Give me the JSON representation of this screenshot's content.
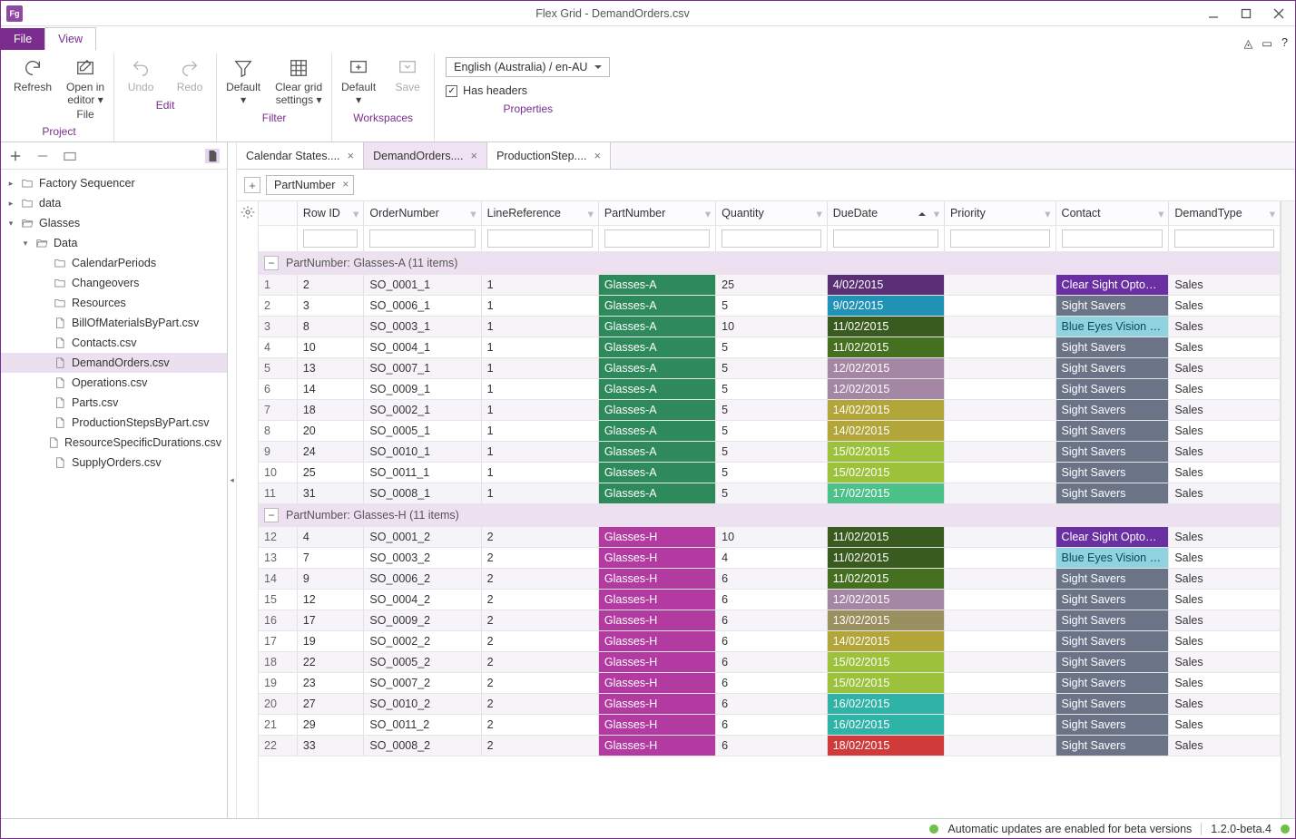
{
  "window_title": "Flex Grid - DemandOrders.csv",
  "menu_tabs": {
    "file": "File",
    "view": "View"
  },
  "ribbon": {
    "project": {
      "refresh": "Refresh",
      "open_in_editor": "Open in\neditor ▾",
      "open_file": "File",
      "group": "Project"
    },
    "edit": {
      "undo": "Undo",
      "redo": "Redo",
      "group": "Edit"
    },
    "filter": {
      "default": "Default\n▾",
      "clear": "Clear grid\nsettings ▾",
      "group": "Filter"
    },
    "workspaces": {
      "default": "Default\n▾",
      "save": "Save",
      "group": "Workspaces"
    },
    "properties": {
      "locale": "English (Australia) / en-AU",
      "has_headers": "Has headers",
      "group": "Properties"
    }
  },
  "sidebar": {
    "nodes": [
      {
        "lvl": 0,
        "twist": "▸",
        "icon": "folder",
        "label": "Factory Sequencer"
      },
      {
        "lvl": 0,
        "twist": "▸",
        "icon": "folder",
        "label": "data"
      },
      {
        "lvl": 0,
        "twist": "▾",
        "icon": "folder-open",
        "label": "Glasses"
      },
      {
        "lvl": 1,
        "twist": "▾",
        "icon": "folder-open",
        "label": "Data"
      },
      {
        "lvl": 2,
        "twist": "",
        "icon": "folder",
        "label": "CalendarPeriods"
      },
      {
        "lvl": 2,
        "twist": "",
        "icon": "folder",
        "label": "Changeovers"
      },
      {
        "lvl": 2,
        "twist": "",
        "icon": "folder",
        "label": "Resources"
      },
      {
        "lvl": 2,
        "twist": "",
        "icon": "file",
        "label": "BillOfMaterialsByPart.csv"
      },
      {
        "lvl": 2,
        "twist": "",
        "icon": "file",
        "label": "Contacts.csv"
      },
      {
        "lvl": 2,
        "twist": "",
        "icon": "file",
        "label": "DemandOrders.csv",
        "sel": true
      },
      {
        "lvl": 2,
        "twist": "",
        "icon": "file",
        "label": "Operations.csv"
      },
      {
        "lvl": 2,
        "twist": "",
        "icon": "file",
        "label": "Parts.csv"
      },
      {
        "lvl": 2,
        "twist": "",
        "icon": "file",
        "label": "ProductionStepsByPart.csv"
      },
      {
        "lvl": 2,
        "twist": "",
        "icon": "file",
        "label": "ResourceSpecificDurations.csv"
      },
      {
        "lvl": 2,
        "twist": "",
        "icon": "file",
        "label": "SupplyOrders.csv"
      }
    ]
  },
  "doc_tabs": [
    {
      "label": "Calendar States....",
      "active": false
    },
    {
      "label": "DemandOrders....",
      "active": true
    },
    {
      "label": "ProductionStep....",
      "active": false
    }
  ],
  "group_chip": "PartNumber",
  "columns": [
    "",
    "Row ID",
    "OrderNumber",
    "LineReference",
    "PartNumber",
    "Quantity",
    "DueDate",
    "Priority",
    "Contact",
    "DemandType"
  ],
  "sorted_col": "DueDate",
  "groups": [
    {
      "title": "PartNumber:  Glasses-A (11 items)",
      "part_color": "#2f8a5b",
      "rows": [
        {
          "n": 1,
          "rowid": "2",
          "order": "SO_0001_1",
          "line": "1",
          "part": "Glasses-A",
          "qty": "25",
          "due": "4/02/2015",
          "due_bg": "#5a2f75",
          "pri": "",
          "contact": "Clear Sight Optometrists",
          "c_bg": "#6a2fa3",
          "dt": "Sales"
        },
        {
          "n": 2,
          "rowid": "3",
          "order": "SO_0006_1",
          "line": "1",
          "part": "Glasses-A",
          "qty": "5",
          "due": "9/02/2015",
          "due_bg": "#1f92b6",
          "pri": "",
          "contact": "Sight Savers",
          "c_bg": "#6b7487",
          "dt": "Sales"
        },
        {
          "n": 3,
          "rowid": "8",
          "order": "SO_0003_1",
          "line": "1",
          "part": "Glasses-A",
          "qty": "10",
          "due": "11/02/2015",
          "due_bg": "#3a5b1f",
          "pri": "",
          "contact": "Blue Eyes Vision Care",
          "c_bg": "#8fd2e0",
          "dt": "Sales"
        },
        {
          "n": 4,
          "rowid": "10",
          "order": "SO_0004_1",
          "line": "1",
          "part": "Glasses-A",
          "qty": "5",
          "due": "11/02/2015",
          "due_bg": "#45701f",
          "pri": "",
          "contact": "Sight Savers",
          "c_bg": "#6b7487",
          "dt": "Sales"
        },
        {
          "n": 5,
          "rowid": "13",
          "order": "SO_0007_1",
          "line": "1",
          "part": "Glasses-A",
          "qty": "5",
          "due": "12/02/2015",
          "due_bg": "#a486a5",
          "pri": "",
          "contact": "Sight Savers",
          "c_bg": "#6b7487",
          "dt": "Sales"
        },
        {
          "n": 6,
          "rowid": "14",
          "order": "SO_0009_1",
          "line": "1",
          "part": "Glasses-A",
          "qty": "5",
          "due": "12/02/2015",
          "due_bg": "#a486a5",
          "pri": "",
          "contact": "Sight Savers",
          "c_bg": "#6b7487",
          "dt": "Sales"
        },
        {
          "n": 7,
          "rowid": "18",
          "order": "SO_0002_1",
          "line": "1",
          "part": "Glasses-A",
          "qty": "5",
          "due": "14/02/2015",
          "due_bg": "#b2a63a",
          "pri": "",
          "contact": "Sight Savers",
          "c_bg": "#6b7487",
          "dt": "Sales"
        },
        {
          "n": 8,
          "rowid": "20",
          "order": "SO_0005_1",
          "line": "1",
          "part": "Glasses-A",
          "qty": "5",
          "due": "14/02/2015",
          "due_bg": "#b2a63a",
          "pri": "",
          "contact": "Sight Savers",
          "c_bg": "#6b7487",
          "dt": "Sales"
        },
        {
          "n": 9,
          "rowid": "24",
          "order": "SO_0010_1",
          "line": "1",
          "part": "Glasses-A",
          "qty": "5",
          "due": "15/02/2015",
          "due_bg": "#9cc23c",
          "pri": "",
          "contact": "Sight Savers",
          "c_bg": "#6b7487",
          "dt": "Sales"
        },
        {
          "n": 10,
          "rowid": "25",
          "order": "SO_0011_1",
          "line": "1",
          "part": "Glasses-A",
          "qty": "5",
          "due": "15/02/2015",
          "due_bg": "#9cc23c",
          "pri": "",
          "contact": "Sight Savers",
          "c_bg": "#6b7487",
          "dt": "Sales"
        },
        {
          "n": 11,
          "rowid": "31",
          "order": "SO_0008_1",
          "line": "1",
          "part": "Glasses-A",
          "qty": "5",
          "due": "17/02/2015",
          "due_bg": "#4cc28a",
          "pri": "",
          "contact": "Sight Savers",
          "c_bg": "#6b7487",
          "dt": "Sales"
        }
      ]
    },
    {
      "title": "PartNumber:  Glasses-H (11 items)",
      "part_color": "#b23aa0",
      "rows": [
        {
          "n": 12,
          "rowid": "4",
          "order": "SO_0001_2",
          "line": "2",
          "part": "Glasses-H",
          "qty": "10",
          "due": "11/02/2015",
          "due_bg": "#3a5b1f",
          "pri": "",
          "contact": "Clear Sight Optometrists",
          "c_bg": "#6a2fa3",
          "dt": "Sales"
        },
        {
          "n": 13,
          "rowid": "7",
          "order": "SO_0003_2",
          "line": "2",
          "part": "Glasses-H",
          "qty": "4",
          "due": "11/02/2015",
          "due_bg": "#3a5b1f",
          "pri": "",
          "contact": "Blue Eyes Vision Care",
          "c_bg": "#8fd2e0",
          "dt": "Sales"
        },
        {
          "n": 14,
          "rowid": "9",
          "order": "SO_0006_2",
          "line": "2",
          "part": "Glasses-H",
          "qty": "6",
          "due": "11/02/2015",
          "due_bg": "#45701f",
          "pri": "",
          "contact": "Sight Savers",
          "c_bg": "#6b7487",
          "dt": "Sales"
        },
        {
          "n": 15,
          "rowid": "12",
          "order": "SO_0004_2",
          "line": "2",
          "part": "Glasses-H",
          "qty": "6",
          "due": "12/02/2015",
          "due_bg": "#a486a5",
          "pri": "",
          "contact": "Sight Savers",
          "c_bg": "#6b7487",
          "dt": "Sales"
        },
        {
          "n": 16,
          "rowid": "17",
          "order": "SO_0009_2",
          "line": "2",
          "part": "Glasses-H",
          "qty": "6",
          "due": "13/02/2015",
          "due_bg": "#9a8f5f",
          "pri": "",
          "contact": "Sight Savers",
          "c_bg": "#6b7487",
          "dt": "Sales"
        },
        {
          "n": 17,
          "rowid": "19",
          "order": "SO_0002_2",
          "line": "2",
          "part": "Glasses-H",
          "qty": "6",
          "due": "14/02/2015",
          "due_bg": "#b2a63a",
          "pri": "",
          "contact": "Sight Savers",
          "c_bg": "#6b7487",
          "dt": "Sales"
        },
        {
          "n": 18,
          "rowid": "22",
          "order": "SO_0005_2",
          "line": "2",
          "part": "Glasses-H",
          "qty": "6",
          "due": "15/02/2015",
          "due_bg": "#9cc23c",
          "pri": "",
          "contact": "Sight Savers",
          "c_bg": "#6b7487",
          "dt": "Sales"
        },
        {
          "n": 19,
          "rowid": "23",
          "order": "SO_0007_2",
          "line": "2",
          "part": "Glasses-H",
          "qty": "6",
          "due": "15/02/2015",
          "due_bg": "#9cc23c",
          "pri": "",
          "contact": "Sight Savers",
          "c_bg": "#6b7487",
          "dt": "Sales"
        },
        {
          "n": 20,
          "rowid": "27",
          "order": "SO_0010_2",
          "line": "2",
          "part": "Glasses-H",
          "qty": "6",
          "due": "16/02/2015",
          "due_bg": "#2fb3a6",
          "pri": "",
          "contact": "Sight Savers",
          "c_bg": "#6b7487",
          "dt": "Sales"
        },
        {
          "n": 21,
          "rowid": "29",
          "order": "SO_0011_2",
          "line": "2",
          "part": "Glasses-H",
          "qty": "6",
          "due": "16/02/2015",
          "due_bg": "#2fb3a6",
          "pri": "",
          "contact": "Sight Savers",
          "c_bg": "#6b7487",
          "dt": "Sales"
        },
        {
          "n": 22,
          "rowid": "33",
          "order": "SO_0008_2",
          "line": "2",
          "part": "Glasses-H",
          "qty": "6",
          "due": "18/02/2015",
          "due_bg": "#d03a3a",
          "pri": "",
          "contact": "Sight Savers",
          "c_bg": "#6b7487",
          "dt": "Sales"
        }
      ]
    }
  ],
  "status": {
    "updates": "Automatic updates are enabled for beta versions",
    "version": "1.2.0-beta.4"
  }
}
